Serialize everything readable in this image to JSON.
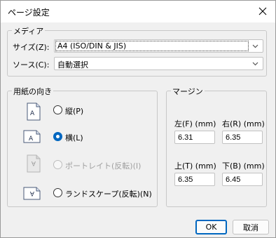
{
  "window": {
    "title": "ページ設定"
  },
  "media": {
    "group_label": "メディア",
    "size_label": "サイズ(Z):",
    "size_value": "A4 (ISO/DIN & JIS)",
    "source_label": "ソース(C):",
    "source_value": "自動選択"
  },
  "orientation": {
    "group_label": "用紙の向き",
    "options": [
      {
        "label": "縦(P)",
        "checked": false,
        "disabled": false
      },
      {
        "label": "横(L)",
        "checked": true,
        "disabled": false
      },
      {
        "label": "ポートレイト(反転)(I)",
        "checked": false,
        "disabled": true
      },
      {
        "label": "ランドスケープ(反転)(N)",
        "checked": false,
        "disabled": false
      }
    ]
  },
  "margins": {
    "group_label": "マージン",
    "left_label": "左(F) (mm)",
    "left_value": "6.31",
    "right_label": "右(R) (mm)",
    "right_value": "6.35",
    "top_label": "上(T) (mm)",
    "top_value": "6.35",
    "bottom_label": "下(B) (mm)",
    "bottom_value": "6.45"
  },
  "buttons": {
    "ok": "OK",
    "cancel": "取消"
  },
  "colors": {
    "accent": "#0067c0",
    "background": "#f0f0f0"
  }
}
